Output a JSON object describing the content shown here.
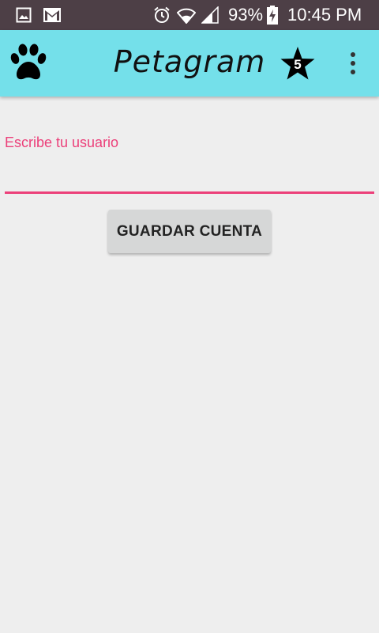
{
  "status_bar": {
    "battery": "93%",
    "time": "10:45 PM",
    "icons": [
      "gallery-icon",
      "gmail-icon",
      "alarm-icon",
      "wifi-icon",
      "signal-icon",
      "battery-charging-icon"
    ]
  },
  "app_bar": {
    "title": "Petagram",
    "left_icon": "paw-icon",
    "favorites_icon": "star-icon",
    "favorites_count": "5",
    "menu_icon": "overflow-menu-icon",
    "background": "#74e0ea"
  },
  "form": {
    "username_label": "Escribe tu usuario",
    "username_value": "",
    "accent": "#ec407a",
    "save_label": "GUARDAR CUENTA"
  },
  "colors": {
    "status_bar": "#4d3f46",
    "background": "#eeeeee",
    "button": "#d6d7d7"
  }
}
